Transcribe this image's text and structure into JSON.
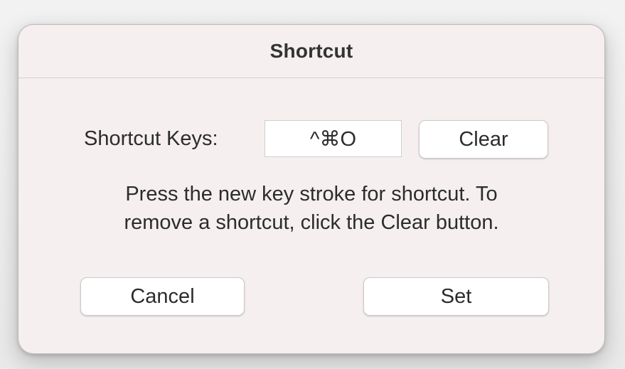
{
  "dialog": {
    "title": "Shortcut",
    "shortcut_label": "Shortcut Keys:",
    "shortcut_value": "^⌘O",
    "clear_label": "Clear",
    "message_line1": "Press the new key stroke for shortcut. To",
    "message_line2": "remove a shortcut, click the Clear button.",
    "cancel_label": "Cancel",
    "set_label": "Set"
  }
}
